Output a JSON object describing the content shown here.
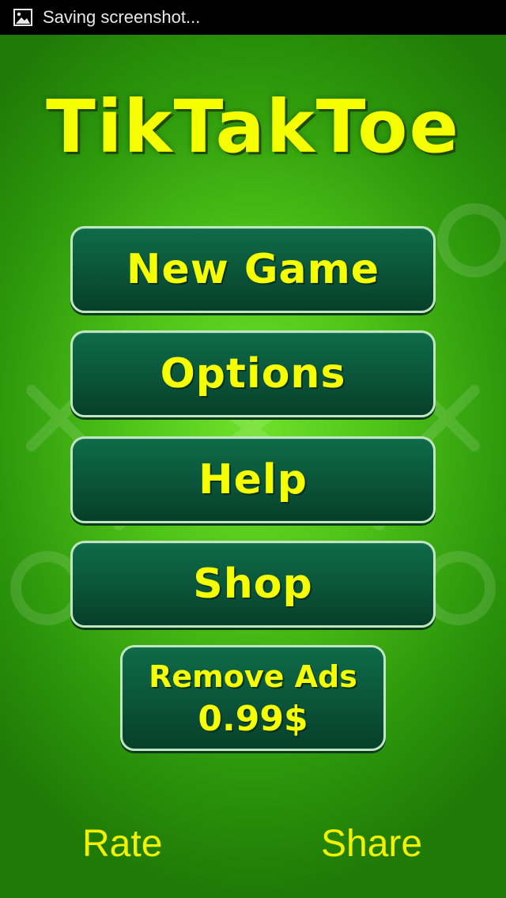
{
  "status_bar": {
    "icon": "image-icon",
    "text": "Saving screenshot..."
  },
  "app": {
    "title": "TikTakToe"
  },
  "menu": {
    "new_game": "New Game",
    "options": "Options",
    "help": "Help",
    "shop": "Shop",
    "remove_ads_line1": "Remove Ads",
    "remove_ads_line2": "0.99$"
  },
  "footer": {
    "rate": "Rate",
    "share": "Share"
  },
  "colors": {
    "accent_text": "#f6ff00",
    "button_bg": "#0a5439",
    "button_border": "#bfe6c0",
    "background": "#4fc418"
  }
}
